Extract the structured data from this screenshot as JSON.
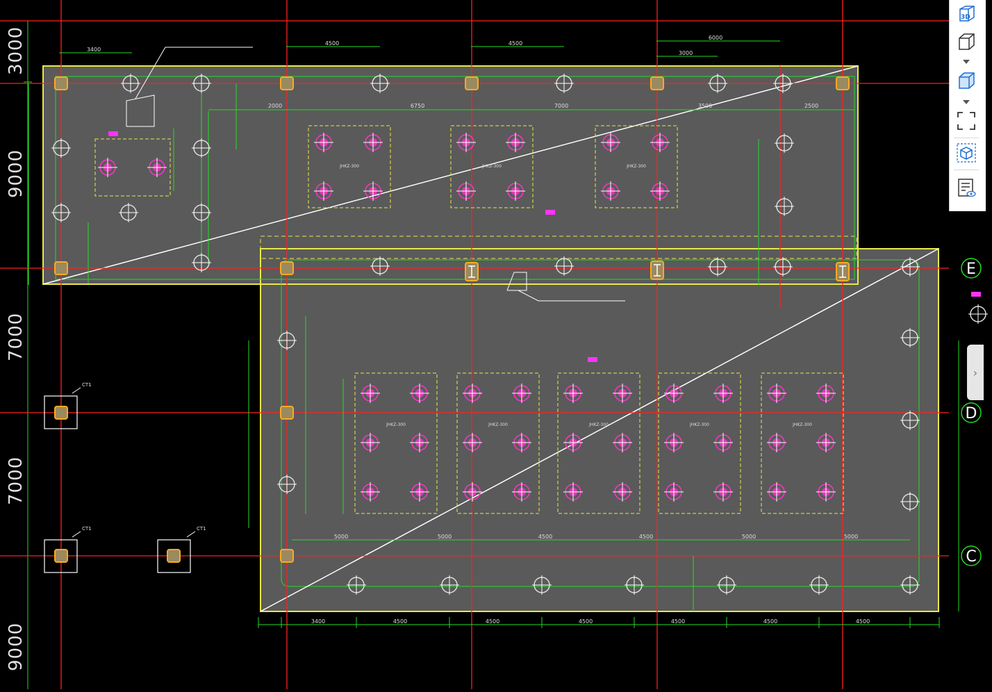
{
  "left_dimensions": [
    "3000",
    "9000",
    "7000",
    "7000",
    "9000"
  ],
  "grid_axes": [
    "E",
    "D",
    "C"
  ],
  "toolbar": {
    "buttons": [
      {
        "label": "3D",
        "icon": "view-3d-icon"
      },
      {
        "label": "",
        "icon": "box-view-icon"
      },
      {
        "label": "",
        "icon": "box-solid-view-icon"
      },
      {
        "label": "",
        "icon": "fit-extents-icon"
      },
      {
        "label": "",
        "icon": "section-box-icon"
      },
      {
        "label": "",
        "icon": "properties-view-icon"
      }
    ]
  },
  "expand_tab": {
    "icon": "chevron-right-icon",
    "label": "›"
  },
  "drawing": {
    "top_dims": [
      "3400",
      "4500",
      "4500",
      "6000",
      "3000"
    ],
    "top_row2_dims": [
      "2000",
      "6750",
      "7000",
      "3500",
      "2500"
    ],
    "pile_groups_top": [
      "JHKZ-300",
      "JHKZ-300",
      "JHKZ-300"
    ],
    "pile_groups_bottom": [
      "JHKZ-300",
      "JHKZ-300",
      "JHKZ-300",
      "JHKZ-300",
      "JHKZ-300"
    ],
    "bottom_dims": [
      "3400",
      "4500",
      "4500",
      "4500",
      "4500",
      "4500",
      "4500"
    ],
    "mid_dims": [
      "5000",
      "5000",
      "4500",
      "4500",
      "5000",
      "5000"
    ],
    "column_labels": [
      "CT1",
      "CT1",
      "CT1"
    ],
    "colors": {
      "grid": "#ff2020",
      "dim": "#22dd22",
      "slab_border": "#e8e84a",
      "slab_fill": "#5a5a5a",
      "pile": "#ff33cc",
      "axis_bubble": "#22dd22"
    }
  }
}
